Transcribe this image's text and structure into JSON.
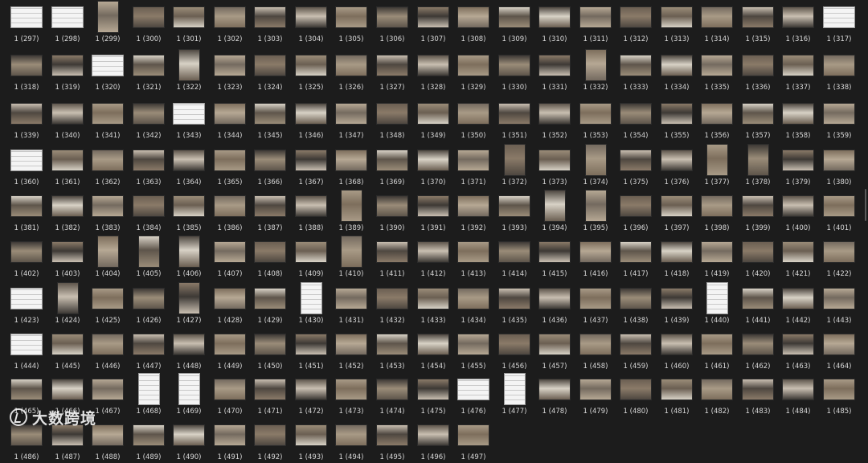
{
  "folder_view": {
    "name_prefix": "1",
    "first_index": 297,
    "last_index": 497,
    "columns": 21
  },
  "watermark": {
    "text": "大数跨境"
  },
  "palette": {
    "background": "#1c1c1c",
    "label_color": "#d8d8d8",
    "thumb_tones": [
      "#8a7a68",
      "#6b5f52",
      "#a89a86",
      "#4e4740",
      "#c9bfb1",
      "#7d6e5c",
      "#9a8c78",
      "#3d3935",
      "#b6a894",
      "#5e554b",
      "#d8d2c6",
      "#746a5f"
    ]
  }
}
